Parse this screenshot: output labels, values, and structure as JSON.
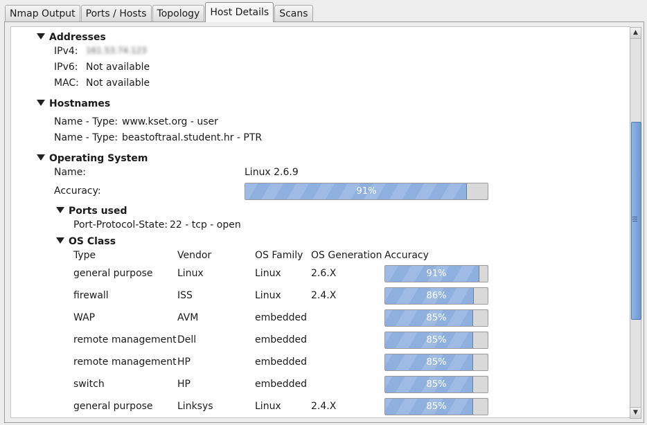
{
  "tabs": [
    "Nmap Output",
    "Ports / Hosts",
    "Topology",
    "Host Details",
    "Scans"
  ],
  "addresses": {
    "title": "Addresses",
    "ipv4_label": "IPv4:",
    "ipv4_value": "161.53.74.123",
    "ipv6_label": "IPv6:",
    "ipv6_value": "Not available",
    "mac_label": "MAC:",
    "mac_value": "Not available"
  },
  "hostnames": {
    "title": "Hostnames",
    "rows": [
      {
        "label": "Name - Type:",
        "value": "www.kset.org - user"
      },
      {
        "label": "Name - Type:",
        "value": "beastoftraal.student.hr - PTR"
      }
    ]
  },
  "os": {
    "title": "Operating System",
    "name_label": "Name:",
    "name_value": "Linux 2.6.9",
    "accuracy_label": "Accuracy:",
    "accuracy_value": 91,
    "accuracy_text": "91%",
    "ports_used_title": "Ports used",
    "pps_label": "Port-Protocol-State:",
    "pps_value": "22 - tcp - open",
    "os_class_title": "OS Class",
    "columns": [
      "Type",
      "Vendor",
      "OS Family",
      "OS Generation",
      "Accuracy"
    ],
    "classes": [
      {
        "type": "general purpose",
        "vendor": "Linux",
        "family": "Linux",
        "gen": "2.6.X",
        "accuracy": 91,
        "accuracy_text": "91%"
      },
      {
        "type": "firewall",
        "vendor": "ISS",
        "family": "Linux",
        "gen": "2.4.X",
        "accuracy": 86,
        "accuracy_text": "86%"
      },
      {
        "type": "WAP",
        "vendor": "AVM",
        "family": "embedded",
        "gen": "",
        "accuracy": 85,
        "accuracy_text": "85%"
      },
      {
        "type": "remote management",
        "vendor": "Dell",
        "family": "embedded",
        "gen": "",
        "accuracy": 85,
        "accuracy_text": "85%"
      },
      {
        "type": "remote management",
        "vendor": "HP",
        "family": "embedded",
        "gen": "",
        "accuracy": 85,
        "accuracy_text": "85%"
      },
      {
        "type": "switch",
        "vendor": "HP",
        "family": "embedded",
        "gen": "",
        "accuracy": 85,
        "accuracy_text": "85%"
      },
      {
        "type": "general purpose",
        "vendor": "Linksys",
        "family": "Linux",
        "gen": "2.4.X",
        "accuracy": 85,
        "accuracy_text": "85%"
      }
    ]
  }
}
